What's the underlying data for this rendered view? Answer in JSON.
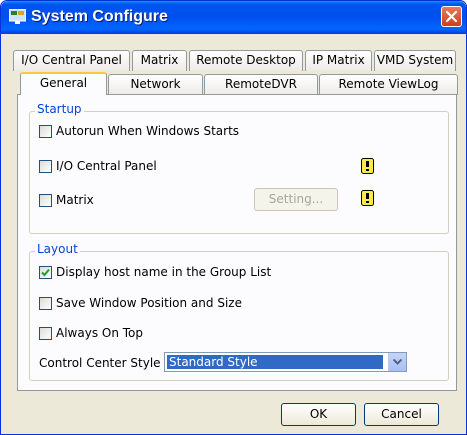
{
  "window": {
    "title": "System Configure",
    "accent": "#0053ee",
    "close_color": "#d6391a"
  },
  "tabs_back": [
    "I/O Central Panel",
    "Matrix",
    "Remote Desktop",
    "IP Matrix",
    "VMD System"
  ],
  "tabs_front": [
    "General",
    "Network",
    "RemoteDVR",
    "Remote ViewLog"
  ],
  "active_tab": "General",
  "startup": {
    "label": "Startup",
    "autorun": {
      "label": "Autorun When Windows Starts",
      "checked": false
    },
    "io_panel": {
      "label": "I/O Central Panel",
      "checked": false,
      "icon": "warning-icon"
    },
    "matrix": {
      "label": "Matrix",
      "checked": false,
      "icon": "warning-icon"
    },
    "setting_button": "Setting..."
  },
  "layout": {
    "label": "Layout",
    "display_host": {
      "label": "Display host name in the Group List",
      "checked": true
    },
    "save_window": {
      "label": "Save Window Position and Size",
      "checked": false
    },
    "always_on_top": {
      "label": "Always On Top",
      "checked": false
    },
    "control_center_label": "Control Center Style",
    "control_center_value": "Standard Style"
  },
  "buttons": {
    "ok": "OK",
    "cancel": "Cancel"
  }
}
